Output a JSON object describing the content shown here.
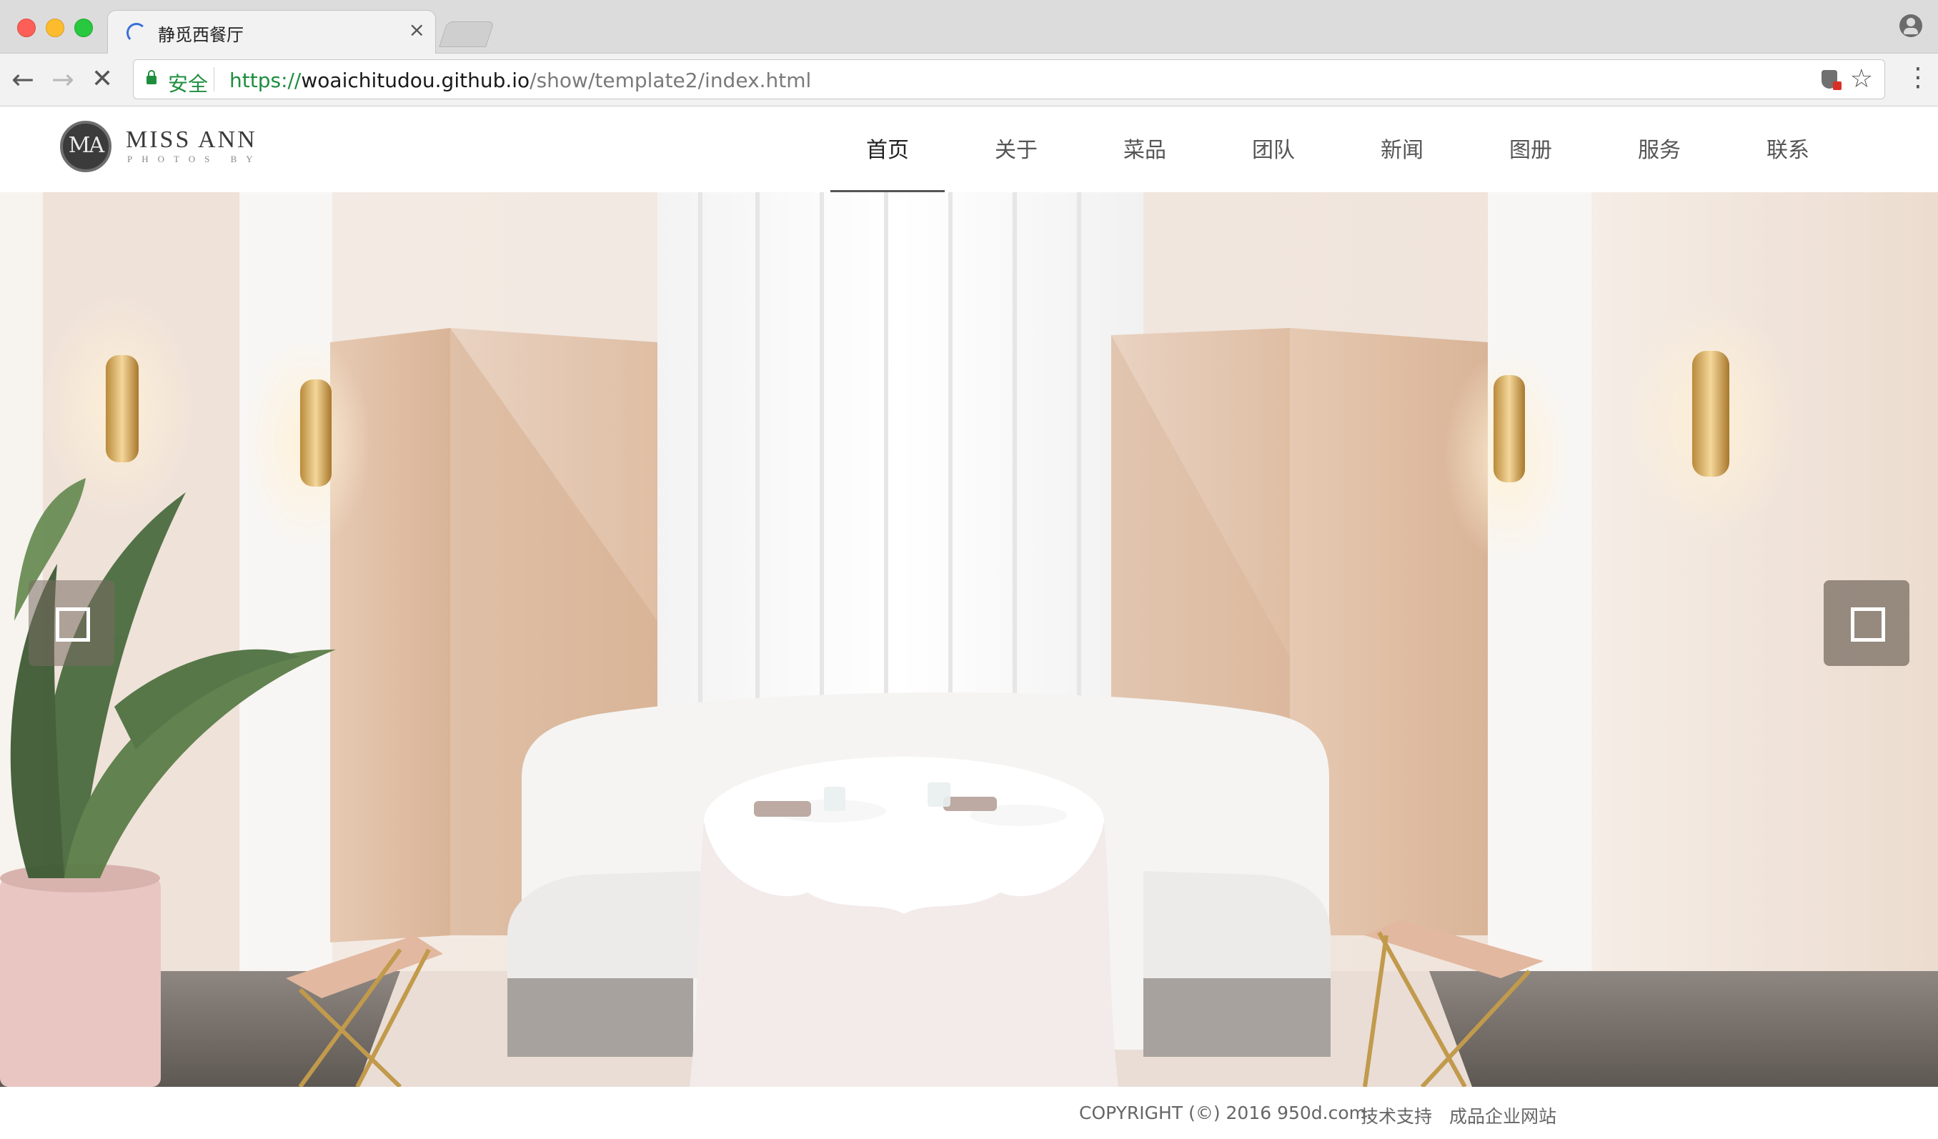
{
  "browser": {
    "tab_title": "静觅西餐厅",
    "tab_close": "×",
    "secure_label": "安全",
    "url_scheme": "https://",
    "url_host": "woaichitudou.github.io",
    "url_path": "/show/template2/index.html",
    "back_glyph": "←",
    "forward_glyph": "→",
    "stop_glyph": "✕",
    "star_glyph": "☆",
    "menu_glyph": "⋮"
  },
  "site": {
    "logo_monogram": "MA",
    "logo_name": "MISS ANN",
    "logo_sub": "PHOTOS BY",
    "nav": [
      {
        "label": "首页",
        "active": true
      },
      {
        "label": "关于",
        "active": false
      },
      {
        "label": "菜品",
        "active": false
      },
      {
        "label": "团队",
        "active": false
      },
      {
        "label": "新闻",
        "active": false
      },
      {
        "label": "图册",
        "active": false
      },
      {
        "label": "服务",
        "active": false
      },
      {
        "label": "联系",
        "active": false
      }
    ]
  },
  "hero": {
    "image_subject": "restaurant interior with round table and curved white sofa",
    "prev_icon": "square-outline-icon",
    "next_icon": "square-outline-icon"
  },
  "footer": {
    "copyright": "COPYRIGHT (©) 2016 950d.com.",
    "support": "技术支持",
    "site_type": "成品企业网站"
  },
  "colors": {
    "secure_green": "#1e8e3e",
    "nav_text": "#555555",
    "slider_button": "#786c62"
  }
}
